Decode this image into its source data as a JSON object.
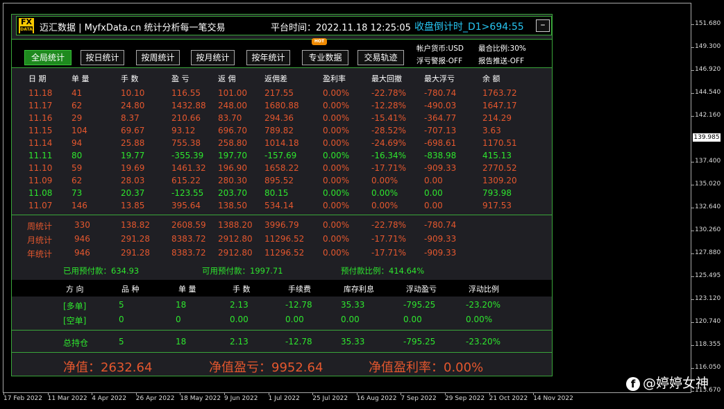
{
  "header": {
    "logo_top": "FX",
    "logo_bottom": "DATA",
    "title": "迈汇数据 | MyfxData.cn  统计分析每一笔交易",
    "platform_time": "平台时间：2022.11.18 12:25:05",
    "countdown": "收盘倒计时_D1>694:55",
    "minimize": "–"
  },
  "toolbar": {
    "buttons": [
      "全局统计",
      "按日统计",
      "按周统计",
      "按月统计",
      "按年统计",
      "专业数据",
      "交易轨迹"
    ],
    "hot_badge": "HOT",
    "account_currency": "帐户货币:USD",
    "float_alert": "浮亏警报-OFF",
    "merge_ratio": "最合比例:30%",
    "report_push": "报告推送-OFF"
  },
  "table": {
    "headers": [
      "日 期",
      "单 量",
      "手 数",
      "盈 亏",
      "返 佣",
      "返佣差",
      "盈利率",
      "最大回撤",
      "最大浮亏",
      "余 额"
    ],
    "rows": [
      {
        "c": [
          "11.18",
          "41",
          "10.10",
          "116.55",
          "101.00",
          "217.55",
          "0.00%",
          "-22.78%",
          "-780.74",
          "1763.72"
        ],
        "color": "red"
      },
      {
        "c": [
          "11.17",
          "62",
          "24.80",
          "1432.88",
          "248.00",
          "1680.88",
          "0.00%",
          "-12.28%",
          "-490.03",
          "1647.17"
        ],
        "color": "red"
      },
      {
        "c": [
          "11.16",
          "29",
          "8.37",
          "210.66",
          "83.70",
          "294.36",
          "0.00%",
          "-15.41%",
          "-364.77",
          "214.29"
        ],
        "color": "red"
      },
      {
        "c": [
          "11.15",
          "104",
          "69.67",
          "93.12",
          "696.70",
          "789.82",
          "0.00%",
          "-28.52%",
          "-707.13",
          "3.63"
        ],
        "color": "red"
      },
      {
        "c": [
          "11.14",
          "94",
          "25.88",
          "755.38",
          "258.80",
          "1014.18",
          "0.00%",
          "-24.69%",
          "-698.61",
          "1170.51"
        ],
        "color": "red"
      },
      {
        "c": [
          "11.11",
          "80",
          "19.77",
          "-355.39",
          "197.70",
          "-157.69",
          "0.00%",
          "-16.34%",
          "-838.98",
          "415.13"
        ],
        "color": "green"
      },
      {
        "c": [
          "11.10",
          "59",
          "19.69",
          "1461.32",
          "196.90",
          "1658.22",
          "0.00%",
          "-17.71%",
          "-909.33",
          "2770.52"
        ],
        "color": "red"
      },
      {
        "c": [
          "11.09",
          "62",
          "28.03",
          "615.22",
          "280.30",
          "895.52",
          "0.00%",
          "0.00%",
          "0.00",
          "1309.20"
        ],
        "color": "red"
      },
      {
        "c": [
          "11.08",
          "73",
          "20.37",
          "-123.55",
          "203.70",
          "80.15",
          "0.00%",
          "0.00%",
          "0.00",
          "793.98"
        ],
        "color": "green"
      },
      {
        "c": [
          "11.07",
          "146",
          "13.85",
          "395.64",
          "138.50",
          "534.14",
          "0.00%",
          "0.00%",
          "0.00",
          "917.53"
        ],
        "color": "red"
      }
    ]
  },
  "summary": [
    {
      "c": [
        "周统计",
        "330",
        "138.82",
        "2608.59",
        "1388.20",
        "3996.79",
        "0.00%",
        "-22.78%",
        "-780.74"
      ]
    },
    {
      "c": [
        "月统计",
        "946",
        "291.28",
        "8383.72",
        "2912.80",
        "11296.52",
        "0.00%",
        "-17.71%",
        "-909.33"
      ]
    },
    {
      "c": [
        "年统计",
        "946",
        "291.28",
        "8383.72",
        "2912.80",
        "11296.52",
        "0.00%",
        "-17.71%",
        "-909.33"
      ]
    }
  ],
  "prepayment": {
    "used": "已用预付款：634.93",
    "available": "可用预付款：1997.71",
    "ratio": "预付款比例：414.64%"
  },
  "positions": {
    "headers": [
      "方 向",
      "品 种",
      "单 量",
      "手 数",
      "手续费",
      "库存利息",
      "浮动盈亏",
      "浮动比例"
    ],
    "rows": [
      {
        "c": [
          "[多单]",
          "5",
          "18",
          "2.13",
          "-12.78",
          "35.33",
          "-795.25",
          "-23.20%"
        ]
      },
      {
        "c": [
          "[空单]",
          "0",
          "0",
          "0.00",
          "0.00",
          "0.00",
          "0.00",
          "0.00%"
        ]
      }
    ],
    "total": {
      "c": [
        "总持仓",
        "5",
        "18",
        "2.13",
        "-12.78",
        "35.33",
        "-795.25",
        "-23.20%"
      ]
    }
  },
  "footer": {
    "equity": "净值：2632.64",
    "equity_pnl": "净值盈亏：9952.64",
    "equity_rate": "净值盈利率：0.00%"
  },
  "price_axis": [
    "151.680",
    "149.300",
    "146.920",
    "144.540",
    "142.160",
    "137.400",
    "135.020",
    "132.640",
    "130.260",
    "127.880",
    "125.495",
    "123.120",
    "120.740",
    "118.355",
    "116.050",
    "113.670"
  ],
  "current_price": "139.985",
  "time_axis": [
    "17 Feb 2022",
    "11 Mar 2022",
    "4 Apr 2022",
    "26 Apr 2022",
    "18 May 2022",
    "9 Jun 2022",
    "1 Jul 2022",
    "25 Jul 2022",
    "16 Aug 2022",
    "7 Sep 2022",
    "29 Sep 2022",
    "21 Oct 2022",
    "14 Nov 2022"
  ],
  "watermark": "@婷婷女神",
  "watermark_icon": "f",
  "colors": {
    "profit": "#e4572e",
    "loss": "#2ee62e",
    "accent": "#27c6f2",
    "border": "#3aa63a"
  }
}
